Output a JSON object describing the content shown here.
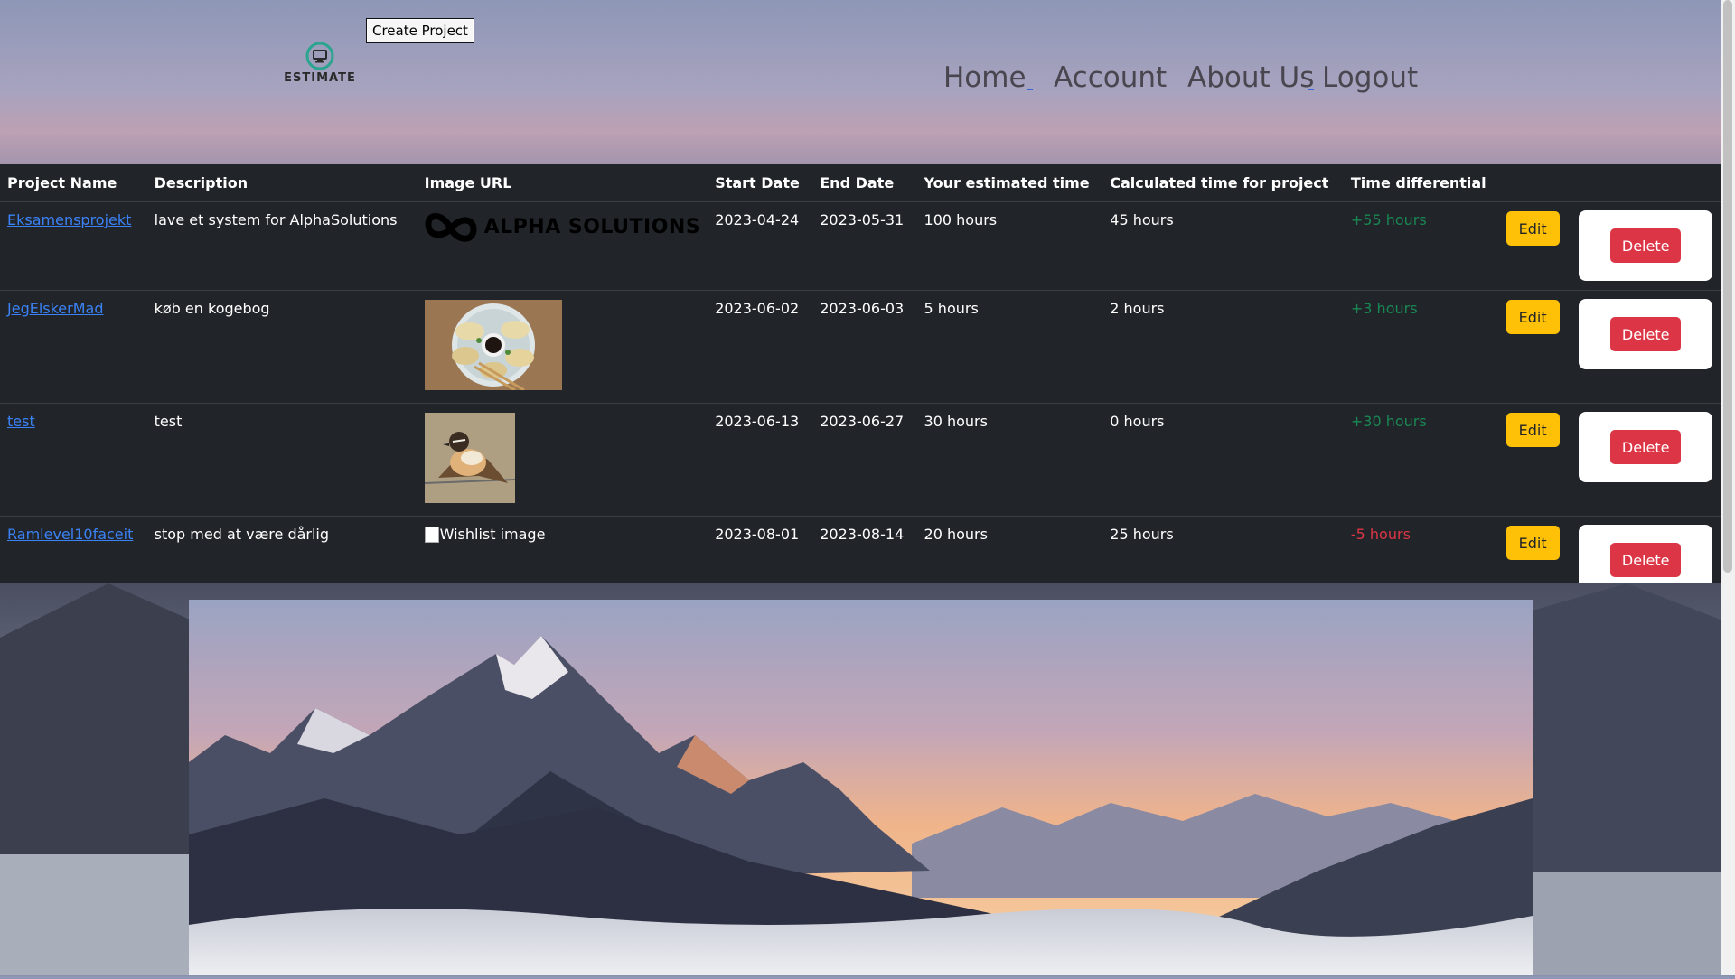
{
  "header": {
    "create_project_label": "Create Project",
    "logo_text": "ESTIMATE",
    "nav": [
      {
        "label": "Home"
      },
      {
        "label": "Account"
      },
      {
        "label": "About Us"
      },
      {
        "label": "Logout"
      }
    ]
  },
  "table": {
    "columns": [
      "Project Name",
      "Description",
      "Image URL",
      "Start Date",
      "End Date",
      "Your estimated time",
      "Calculated time for project",
      "Time differential"
    ],
    "rows": [
      {
        "name": "Eksamensprojekt",
        "description": "lave et system for AlphaSolutions",
        "image": "alpha-solutions-logo",
        "image_text": "ALPHA SOLUTIONS",
        "start": "2023-04-24",
        "end": "2023-05-31",
        "estimated": "100 hours",
        "calculated": "45 hours",
        "diff": "+55 hours",
        "diff_sign": "positive"
      },
      {
        "name": "JegElskerMad",
        "description": "køb en kogebog",
        "image": "dumplings-photo",
        "start": "2023-06-02",
        "end": "2023-06-03",
        "estimated": "5 hours",
        "calculated": "2 hours",
        "diff": "+3 hours",
        "diff_sign": "positive"
      },
      {
        "name": "test",
        "description": "test",
        "image": "bird-photo",
        "start": "2023-06-13",
        "end": "2023-06-27",
        "estimated": "30 hours",
        "calculated": "0 hours",
        "diff": "+30 hours",
        "diff_sign": "positive"
      },
      {
        "name": "Ramlevel10faceit",
        "description": "stop med at være dårlig",
        "image": "broken-image",
        "image_alt": "Wishlist image",
        "start": "2023-08-01",
        "end": "2023-08-14",
        "estimated": "20 hours",
        "calculated": "25 hours",
        "diff": "-5 hours",
        "diff_sign": "negative"
      }
    ],
    "edit_label": "Edit",
    "delete_label": "Delete"
  },
  "colors": {
    "table_bg": "#212529",
    "link": "#3b82f6",
    "edit": "#ffc107",
    "delete": "#dc3545",
    "positive": "#198754",
    "negative": "#dc3545"
  },
  "hero": {
    "image": "mountain-sunset-photo"
  }
}
